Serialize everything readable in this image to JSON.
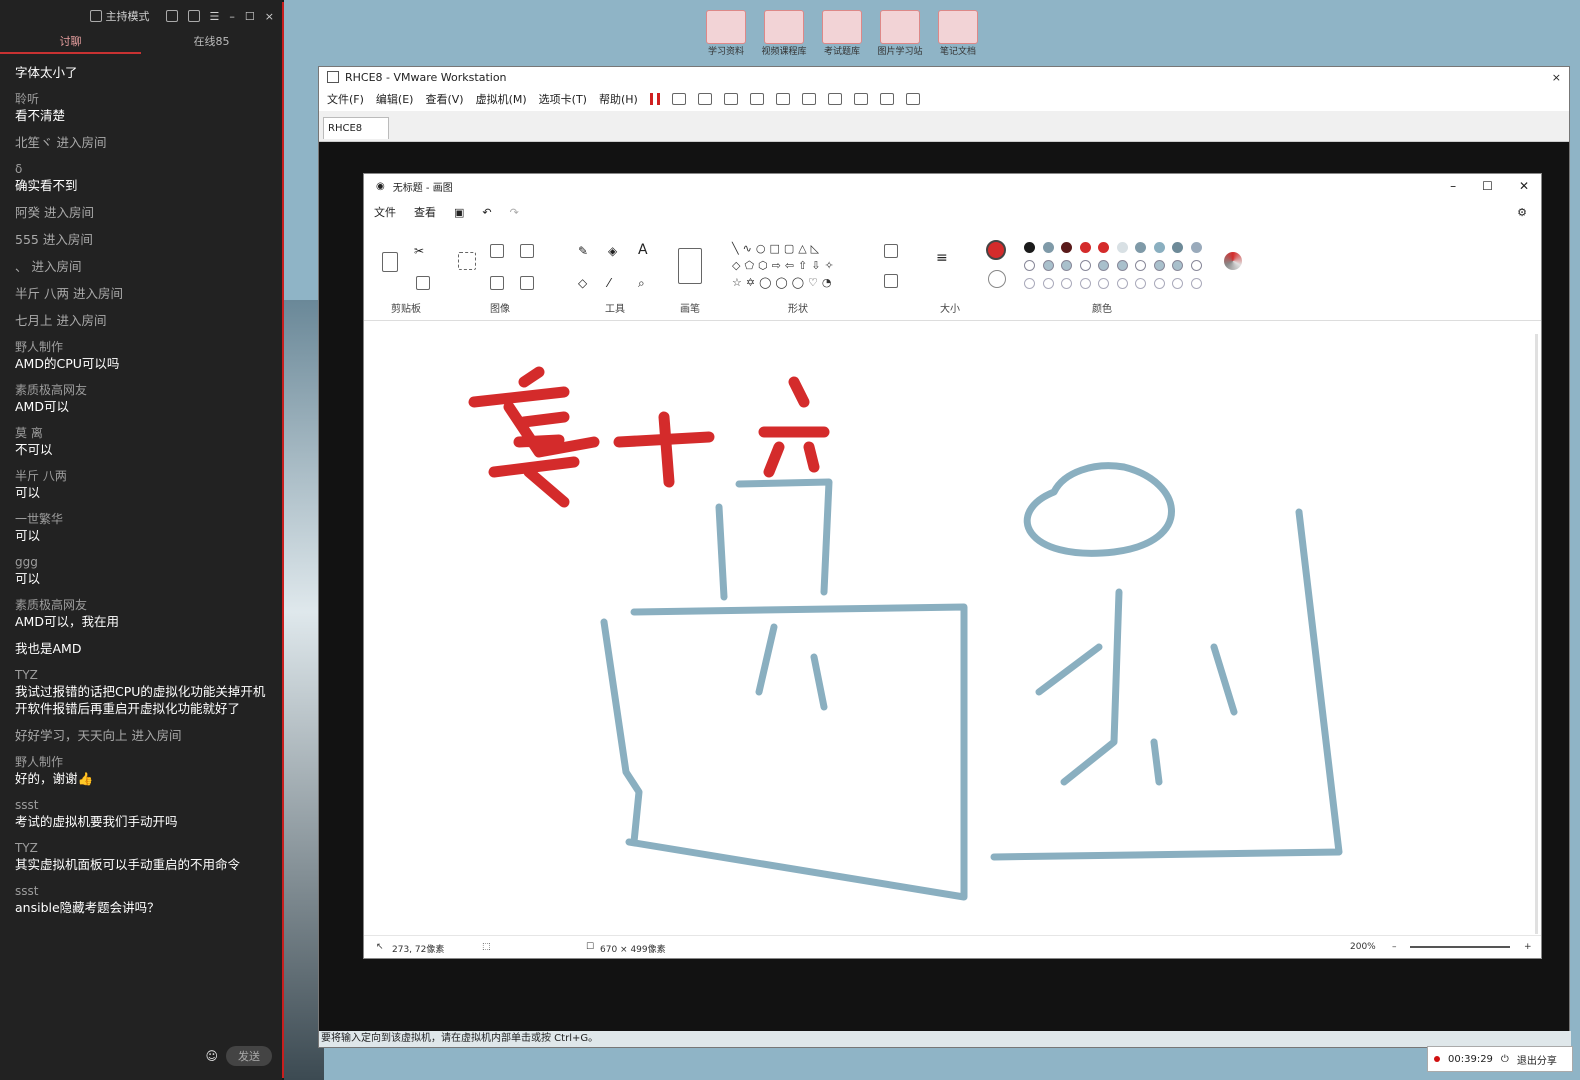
{
  "chat": {
    "header": {
      "mode_label": "主持模式"
    },
    "tabs": [
      {
        "label": "讨聊"
      },
      {
        "label": "在线85"
      }
    ],
    "send_label": "发送",
    "messages": [
      {
        "nick": "",
        "text": "字体太小了",
        "type": "msg"
      },
      {
        "nick": "聆听",
        "text": "看不清楚",
        "type": "msg"
      },
      {
        "nick": "",
        "text": "北笙ヾ 进入房间",
        "type": "join"
      },
      {
        "nick": "δ",
        "text": "确实看不到",
        "type": "msg"
      },
      {
        "nick": "",
        "text": "阿癸 进入房间",
        "type": "join"
      },
      {
        "nick": "",
        "text": "555 进入房间",
        "type": "join"
      },
      {
        "nick": "",
        "text": "、 进入房间",
        "type": "join"
      },
      {
        "nick": "",
        "text": "半斤 八两 进入房间",
        "type": "join"
      },
      {
        "nick": "",
        "text": "七月上 进入房间",
        "type": "join"
      },
      {
        "nick": "野人制作",
        "text": "AMD的CPU可以吗",
        "type": "msg"
      },
      {
        "nick": "素质极高网友",
        "text": "AMD可以",
        "type": "msg"
      },
      {
        "nick": "莫 离",
        "text": "不可以",
        "type": "msg"
      },
      {
        "nick": "半斤 八两",
        "text": "可以",
        "type": "msg"
      },
      {
        "nick": "一世繁华",
        "text": "可以",
        "type": "msg"
      },
      {
        "nick": "ggg",
        "text": "可以",
        "type": "msg"
      },
      {
        "nick": "素质极高网友",
        "text": "AMD可以，我在用",
        "type": "msg"
      },
      {
        "nick": "",
        "text": "我也是AMD",
        "type": "msg"
      },
      {
        "nick": "TYZ",
        "text": "我试过报错的话把CPU的虚拟化功能关掉开机开软件报错后再重启开虚拟化功能就好了",
        "type": "msg"
      },
      {
        "nick": "",
        "text": "好好学习，天天向上 进入房间",
        "type": "join"
      },
      {
        "nick": "野人制作",
        "text": "好的，谢谢👍",
        "type": "msg"
      },
      {
        "nick": "ssst",
        "text": "考试的虚拟机要我们手动开吗",
        "type": "msg"
      },
      {
        "nick": "TYZ",
        "text": "其实虚拟机面板可以手动重启的不用命令",
        "type": "msg"
      },
      {
        "nick": "ssst",
        "text": "ansible隐藏考题会讲吗？",
        "type": "msg"
      }
    ]
  },
  "desktop_icons": [
    {
      "label": "学习资料"
    },
    {
      "label": "视频课程库"
    },
    {
      "label": "考试题库"
    },
    {
      "label": "图片学习站"
    },
    {
      "label": "笔记文档"
    }
  ],
  "vmware": {
    "title": "RHCE8 - VMware Workstation",
    "menu": [
      "文件(F)",
      "编辑(E)",
      "查看(V)",
      "虚拟机(M)",
      "选项卡(T)",
      "帮助(H)"
    ],
    "tab": "RHCE8",
    "status": "要将输入定向到该虚拟机，请在虚拟机内部单击或按 Ctrl+G。"
  },
  "paint": {
    "title": "无标题 - 画图",
    "menu": [
      "文件",
      "查看"
    ],
    "groups": [
      "剪贴板",
      "图像",
      "工具",
      "画笔",
      "形状",
      "大小",
      "颜色"
    ],
    "status": {
      "pos": "273, 72像素",
      "size": "670 × 499像素",
      "zoom": "200%"
    }
  },
  "recording": {
    "time": "00:39:29",
    "stop_label": "退出分享"
  },
  "colors": {
    "accent_red": "#c81e1e",
    "stroke_red": "#d42b2b",
    "stroke_blue": "#8aafc0"
  }
}
